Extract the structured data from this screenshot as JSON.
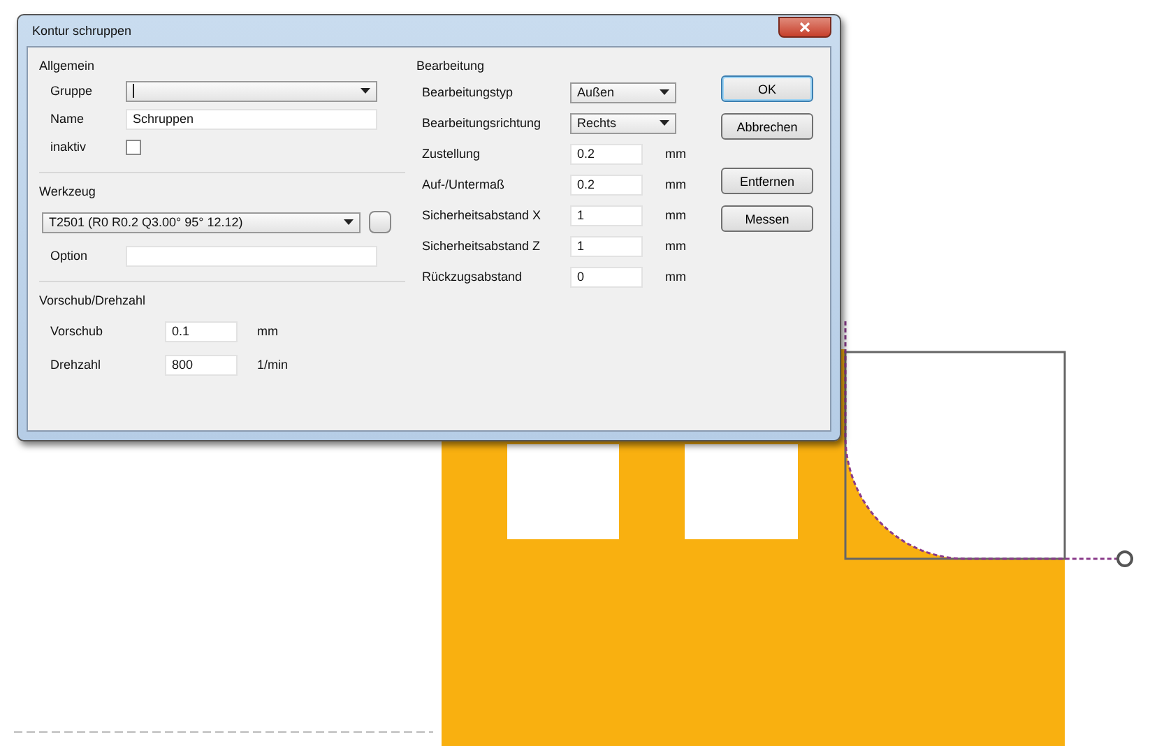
{
  "window": {
    "title": "Kontur schruppen"
  },
  "general": {
    "title": "Allgemein",
    "fields": [
      {
        "kind": "combo",
        "label": "Gruppe"
      },
      {
        "kind": "input",
        "label": "Name",
        "value": "Schruppen"
      },
      {
        "kind": "checkbox",
        "label": "inaktiv",
        "checked": false
      }
    ]
  },
  "tool": {
    "title": "Werkzeug",
    "value": "T2501 (R0 R0.2 Q3.00° 95° 12.12)",
    "option_label": "Option"
  },
  "feed": {
    "title": "Vorschub/Drehzahl",
    "rows": [
      {
        "label": "Vorschub",
        "value": "0.1",
        "unit": "mm"
      },
      {
        "label": "Drehzahl",
        "value": "800",
        "unit": "1/min"
      }
    ]
  },
  "machining": {
    "title": "Bearbeitung",
    "rows": [
      {
        "kind": "combo",
        "label": "Bearbeitungstyp",
        "value": "Außen"
      },
      {
        "kind": "combo",
        "label": "Bearbeitungsrichtung",
        "value": "Rechts"
      },
      {
        "kind": "input",
        "label": "Zustellung",
        "value": "0.2",
        "unit": "mm"
      },
      {
        "kind": "input",
        "label": "Auf-/Untermaß",
        "value": "0.2",
        "unit": "mm"
      },
      {
        "kind": "input",
        "label": "Sicherheitsabstand X",
        "value": "1",
        "unit": "mm"
      },
      {
        "kind": "input",
        "label": "Sicherheitsabstand Z",
        "value": "1",
        "unit": "mm"
      },
      {
        "kind": "input",
        "label": "Rückzugsabstand",
        "value": "0",
        "unit": "mm"
      }
    ]
  },
  "buttons": [
    {
      "label": "OK",
      "default": true
    },
    {
      "label": "Abbrechen",
      "default": false
    },
    {
      "label": "Entfernen",
      "default": false
    },
    {
      "label": "Messen",
      "default": false
    }
  ]
}
